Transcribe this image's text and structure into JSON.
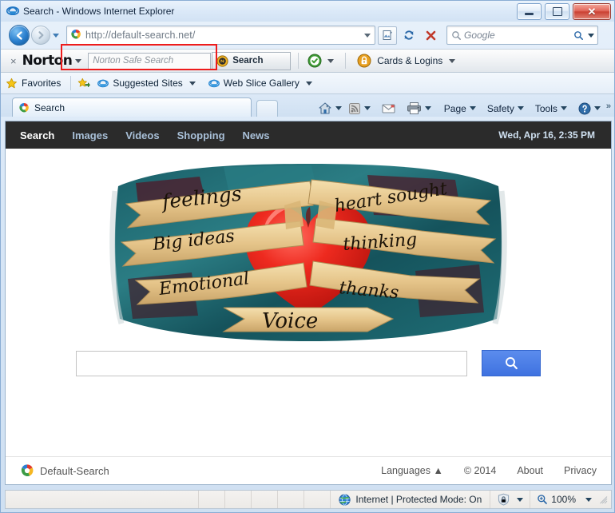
{
  "window": {
    "title": "Search - Windows Internet Explorer",
    "icon": "ie-icon",
    "controls": {
      "minimize": "minimize-button",
      "maximize": "maximize-button",
      "close": "close-button"
    }
  },
  "addressbar": {
    "back": "back-button",
    "forward": "forward-button",
    "recent_pages": "recent-pages-dropdown",
    "url": "http://default-search.net/",
    "site_icon": "default-search-favicon",
    "compat_view": "compatibility-view-button",
    "refresh": "refresh-button",
    "stop": "stop-button",
    "search_placeholder": "Google",
    "search_value": "",
    "search_icon": "magnifier-icon",
    "search_dropdown": "search-provider-dropdown",
    "highlight": "address-field-highlight"
  },
  "norton_toolbar": {
    "close_label": "×",
    "brand": "Norton",
    "brand_dropdown": "norton-menu-caret",
    "safe_search_placeholder": "Norton Safe Search",
    "safe_search_value": "",
    "search_button_label": "Search",
    "search_button_icon": "norton-badge-icon",
    "status_icon": "norton-safe-check-icon",
    "status_dropdown": "norton-status-caret",
    "cards_icon": "padlock-icon",
    "cards_label": "Cards & Logins",
    "cards_dropdown": "cards-logins-caret"
  },
  "favorites_bar": {
    "favorites_label": "Favorites",
    "favorites_icon": "star-icon",
    "add_icon": "add-to-favorites-icon",
    "items": [
      {
        "label": "Suggested Sites",
        "icon": "ie-page-icon"
      },
      {
        "label": "Web Slice Gallery",
        "icon": "ie-page-icon"
      }
    ]
  },
  "tabbar": {
    "tabs": [
      {
        "label": "Search",
        "icon": "default-search-favicon",
        "active": true
      }
    ],
    "new_tab": "new-tab-button"
  },
  "command_bar": {
    "items": [
      {
        "name": "home",
        "icon": "home-icon",
        "label": "",
        "caret": true
      },
      {
        "name": "feeds",
        "icon": "rss-icon",
        "label": "",
        "caret": true
      },
      {
        "name": "read-mail",
        "icon": "mail-icon",
        "label": "",
        "caret": false
      },
      {
        "name": "print",
        "icon": "printer-icon",
        "label": "",
        "caret": true
      },
      {
        "name": "page",
        "icon": "",
        "label": "Page",
        "caret": true
      },
      {
        "name": "safety",
        "icon": "",
        "label": "Safety",
        "caret": true
      },
      {
        "name": "tools",
        "icon": "",
        "label": "Tools",
        "caret": true
      },
      {
        "name": "help",
        "icon": "help-icon",
        "label": "",
        "caret": true
      }
    ],
    "overflow": "»"
  },
  "page": {
    "nav": {
      "items": [
        {
          "label": "Search",
          "active": true
        },
        {
          "label": "Images",
          "active": false
        },
        {
          "label": "Videos",
          "active": false
        },
        {
          "label": "Shopping",
          "active": false
        },
        {
          "label": "News",
          "active": false
        }
      ],
      "datetime": "Wed, Apr 16, 2:35 PM"
    },
    "hero": {
      "alt": "heart-and-ribbons-illustration",
      "ribbons": [
        "feelings",
        "Big ideas",
        "Emotional",
        "Voice",
        "heart sought",
        "thinking",
        "thanks"
      ],
      "colors": {
        "background_teal": "#1d6b73",
        "background_dark": "#4a2230",
        "ribbon": "#e8c98c",
        "heart": "#e8221c"
      }
    },
    "search": {
      "value": "",
      "placeholder": "",
      "button_icon": "magnifier-icon",
      "button_color": "#4a7fe6"
    },
    "footer": {
      "brand": "Default-Search",
      "brand_icon": "default-search-logo",
      "links": [
        "Languages ▲",
        "© 2014",
        "About",
        "Privacy"
      ]
    }
  },
  "statusbar": {
    "zone_icon": "internet-globe-icon",
    "zone_text": "Internet | Protected Mode: On",
    "security_icon": "protected-mode-icon",
    "security_caret": "security-caret",
    "zoom_icon": "zoom-magnifier-icon",
    "zoom_level": "100%",
    "zoom_caret": "zoom-caret",
    "resize_grip": "resize-grip"
  }
}
